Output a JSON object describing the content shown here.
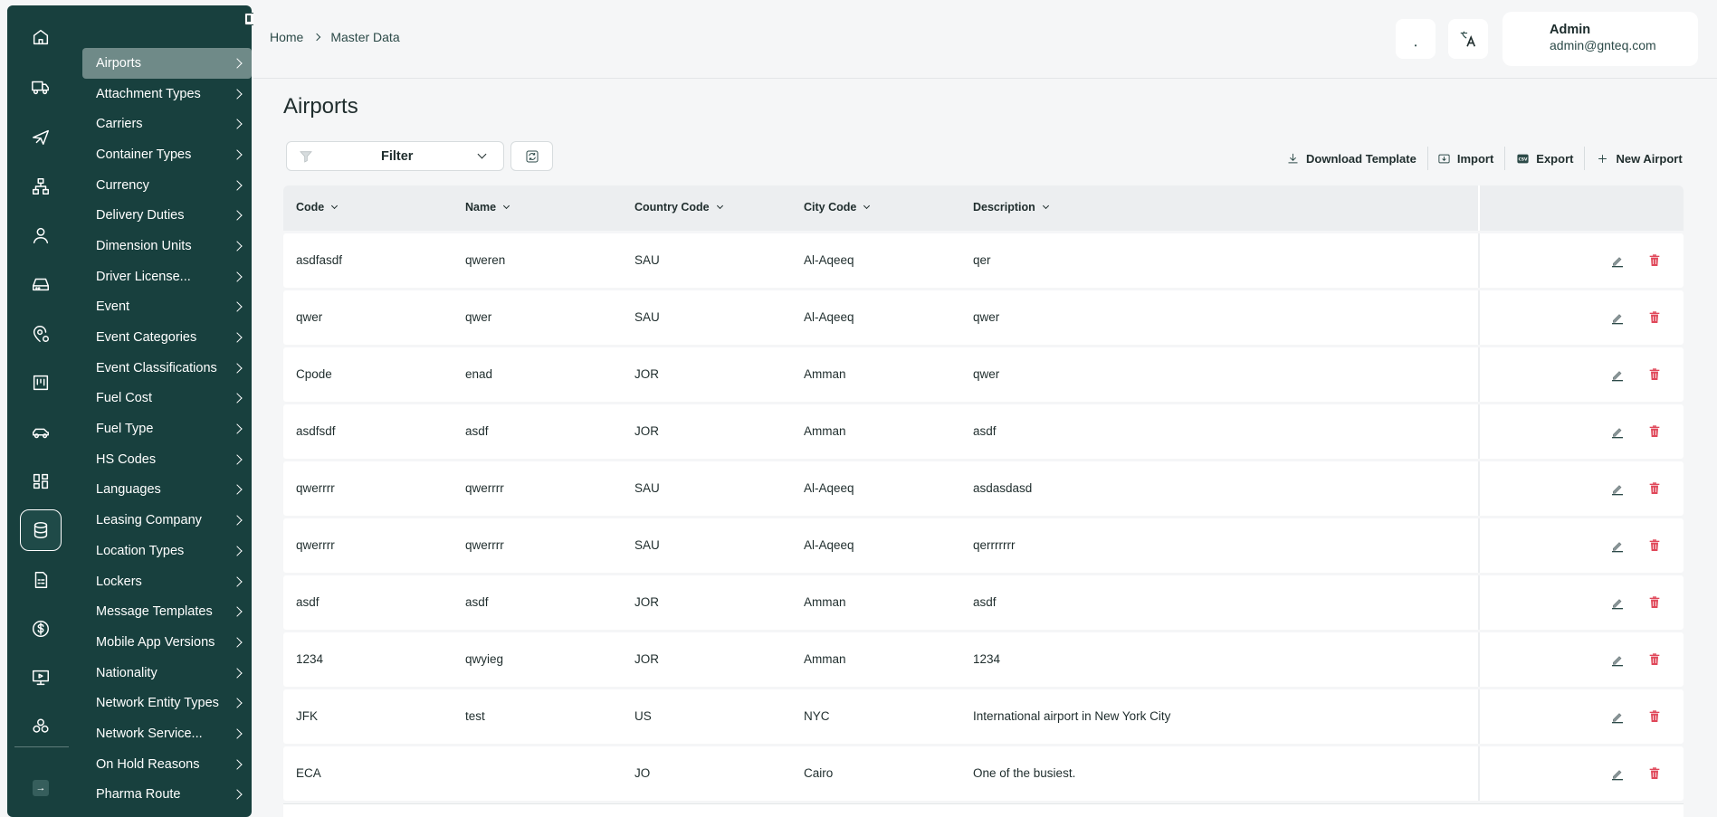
{
  "sidebar": {
    "rail_icons": [
      "home-icon",
      "truck-icon",
      "plane-icon",
      "hierarchy-icon",
      "user-icon",
      "drive-icon",
      "location-settings-icon",
      "board-icon",
      "car-icon",
      "dashboard-icon",
      "database-icon",
      "document-icon",
      "dollar-icon",
      "monitor-icon",
      "settings-cluster-icon"
    ],
    "active_rail": "database-icon",
    "items": [
      {
        "label": "Airports"
      },
      {
        "label": "Attachment Types"
      },
      {
        "label": "Carriers"
      },
      {
        "label": "Container Types"
      },
      {
        "label": "Currency"
      },
      {
        "label": "Delivery Duties"
      },
      {
        "label": "Dimension Units"
      },
      {
        "label": "Driver License..."
      },
      {
        "label": "Event"
      },
      {
        "label": "Event Categories"
      },
      {
        "label": "Event Classifications"
      },
      {
        "label": "Fuel Cost"
      },
      {
        "label": "Fuel Type"
      },
      {
        "label": "HS Codes"
      },
      {
        "label": "Languages"
      },
      {
        "label": "Leasing Company"
      },
      {
        "label": "Location Types"
      },
      {
        "label": "Lockers"
      },
      {
        "label": "Message Templates"
      },
      {
        "label": "Mobile App Versions"
      },
      {
        "label": "Nationality"
      },
      {
        "label": "Network Entity Types"
      },
      {
        "label": "Network Service..."
      },
      {
        "label": "On Hold Reasons"
      },
      {
        "label": "Pharma Route"
      }
    ],
    "active_item": "Airports"
  },
  "header": {
    "breadcrumb": [
      "Home",
      "Master Data"
    ],
    "user": {
      "name": "Admin",
      "email": "admin@gnteq.com"
    }
  },
  "main": {
    "title": "Airports",
    "filter_label": "Filter",
    "actions": {
      "download_template": "Download Template",
      "import": "Import",
      "export": "Export",
      "new": "New Airport"
    },
    "table": {
      "columns": [
        "Code",
        "Name",
        "Country Code",
        "City Code",
        "Description"
      ],
      "rows": [
        [
          "asdfasdf",
          "qweren",
          "SAU",
          "Al-Aqeeq",
          "qer"
        ],
        [
          "qwer",
          "qwer",
          "SAU",
          "Al-Aqeeq",
          "qwer"
        ],
        [
          "Cpode",
          "enad",
          "JOR",
          "Amman",
          "qwer"
        ],
        [
          "asdfsdf",
          "asdf",
          "JOR",
          "Amman",
          "asdf"
        ],
        [
          "qwerrrr",
          "qwerrrr",
          "SAU",
          "Al-Aqeeq",
          "asdasdasd"
        ],
        [
          "qwerrrr",
          "qwerrrr",
          "SAU",
          "Al-Aqeeq",
          "qerrrrrrr"
        ],
        [
          "asdf",
          "asdf",
          "JOR",
          "Amman",
          "asdf"
        ],
        [
          "1234",
          "qwyieg",
          "JOR",
          "Amman",
          "1234"
        ],
        [
          "JFK",
          "test",
          "US",
          "NYC",
          "International airport in New York City"
        ],
        [
          "ECA",
          "",
          "JO",
          "Cairo",
          "One of the busiest."
        ]
      ]
    }
  },
  "colors": {
    "sidebar_bg": "#18403e",
    "active_item_bg": "#6f8a88",
    "delete_red": "#e0485a"
  }
}
